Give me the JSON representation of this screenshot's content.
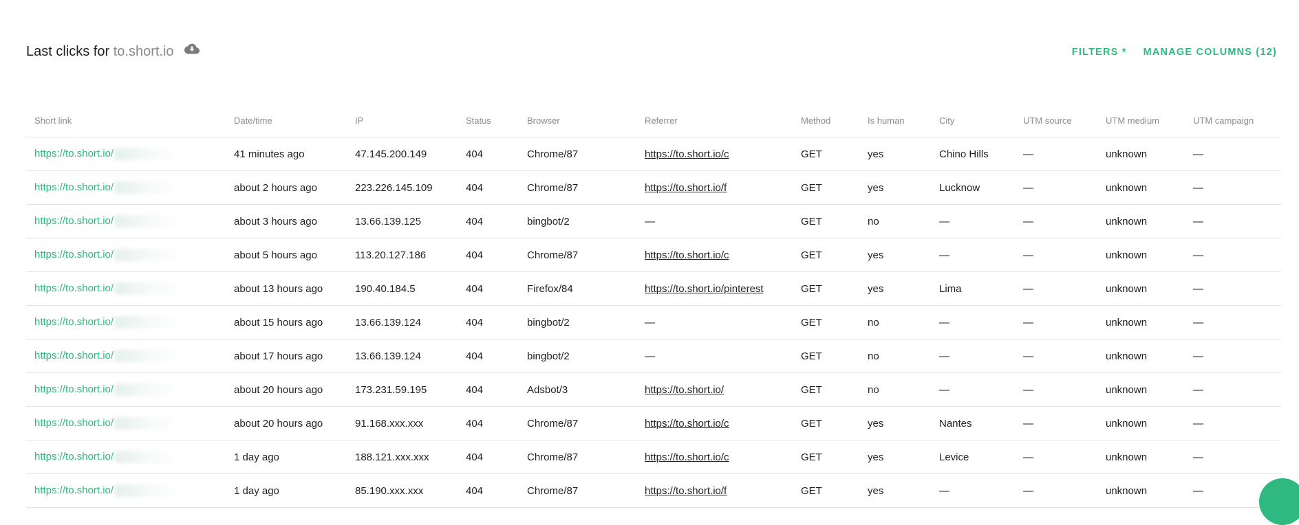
{
  "header": {
    "title_prefix": "Last clicks for",
    "domain": "to.short.io",
    "download_icon": "cloud-download-icon",
    "filters_label": "FILTERS *",
    "manage_columns_label": "MANAGE COLUMNS (12)"
  },
  "colors": {
    "accent": "#2fb87f",
    "text": "#222222",
    "muted": "#8c8c8c",
    "divider": "#e3e3e3"
  },
  "table": {
    "columns": [
      "Short link",
      "Date/time",
      "IP",
      "Status",
      "Browser",
      "Referrer",
      "Method",
      "Is human",
      "City",
      "UTM source",
      "UTM medium",
      "UTM campaign"
    ],
    "rows": [
      {
        "short": "https://to.short.io/",
        "time": "41 minutes ago",
        "ip": "47.145.200.149",
        "status": "404",
        "browser": "Chrome/87",
        "referrer": "https://to.short.io/c",
        "method": "GET",
        "human": "yes",
        "city": "Chino Hills",
        "utm_source": "—",
        "utm_medium": "unknown",
        "utm_campaign": "—"
      },
      {
        "short": "https://to.short.io/",
        "time": "about 2 hours ago",
        "ip": "223.226.145.109",
        "status": "404",
        "browser": "Chrome/87",
        "referrer": "https://to.short.io/f",
        "method": "GET",
        "human": "yes",
        "city": "Lucknow",
        "utm_source": "—",
        "utm_medium": "unknown",
        "utm_campaign": "—"
      },
      {
        "short": "https://to.short.io/",
        "time": "about 3 hours ago",
        "ip": "13.66.139.125",
        "status": "404",
        "browser": "bingbot/2",
        "referrer": "—",
        "method": "GET",
        "human": "no",
        "city": "—",
        "utm_source": "—",
        "utm_medium": "unknown",
        "utm_campaign": "—"
      },
      {
        "short": "https://to.short.io/",
        "time": "about 5 hours ago",
        "ip": "113.20.127.186",
        "status": "404",
        "browser": "Chrome/87",
        "referrer": "https://to.short.io/c",
        "method": "GET",
        "human": "yes",
        "city": "—",
        "utm_source": "—",
        "utm_medium": "unknown",
        "utm_campaign": "—"
      },
      {
        "short": "https://to.short.io/",
        "time": "about 13 hours ago",
        "ip": "190.40.184.5",
        "status": "404",
        "browser": "Firefox/84",
        "referrer": "https://to.short.io/pinterest",
        "method": "GET",
        "human": "yes",
        "city": "Lima",
        "utm_source": "—",
        "utm_medium": "unknown",
        "utm_campaign": "—"
      },
      {
        "short": "https://to.short.io/",
        "time": "about 15 hours ago",
        "ip": "13.66.139.124",
        "status": "404",
        "browser": "bingbot/2",
        "referrer": "—",
        "method": "GET",
        "human": "no",
        "city": "—",
        "utm_source": "—",
        "utm_medium": "unknown",
        "utm_campaign": "—"
      },
      {
        "short": "https://to.short.io/",
        "time": "about 17 hours ago",
        "ip": "13.66.139.124",
        "status": "404",
        "browser": "bingbot/2",
        "referrer": "—",
        "method": "GET",
        "human": "no",
        "city": "—",
        "utm_source": "—",
        "utm_medium": "unknown",
        "utm_campaign": "—"
      },
      {
        "short": "https://to.short.io/",
        "time": "about 20 hours ago",
        "ip": "173.231.59.195",
        "status": "404",
        "browser": "Adsbot/3",
        "referrer": "https://to.short.io/",
        "method": "GET",
        "human": "no",
        "city": "—",
        "utm_source": "—",
        "utm_medium": "unknown",
        "utm_campaign": "—"
      },
      {
        "short": "https://to.short.io/",
        "time": "about 20 hours ago",
        "ip": "91.168.xxx.xxx",
        "status": "404",
        "browser": "Chrome/87",
        "referrer": "https://to.short.io/c",
        "method": "GET",
        "human": "yes",
        "city": "Nantes",
        "utm_source": "—",
        "utm_medium": "unknown",
        "utm_campaign": "—"
      },
      {
        "short": "https://to.short.io/",
        "time": "1 day ago",
        "ip": "188.121.xxx.xxx",
        "status": "404",
        "browser": "Chrome/87",
        "referrer": "https://to.short.io/c",
        "method": "GET",
        "human": "yes",
        "city": "Levice",
        "utm_source": "—",
        "utm_medium": "unknown",
        "utm_campaign": "—"
      },
      {
        "short": "https://to.short.io/",
        "time": "1 day ago",
        "ip": "85.190.xxx.xxx",
        "status": "404",
        "browser": "Chrome/87",
        "referrer": "https://to.short.io/f",
        "method": "GET",
        "human": "yes",
        "city": "—",
        "utm_source": "—",
        "utm_medium": "unknown",
        "utm_campaign": "—"
      }
    ]
  }
}
